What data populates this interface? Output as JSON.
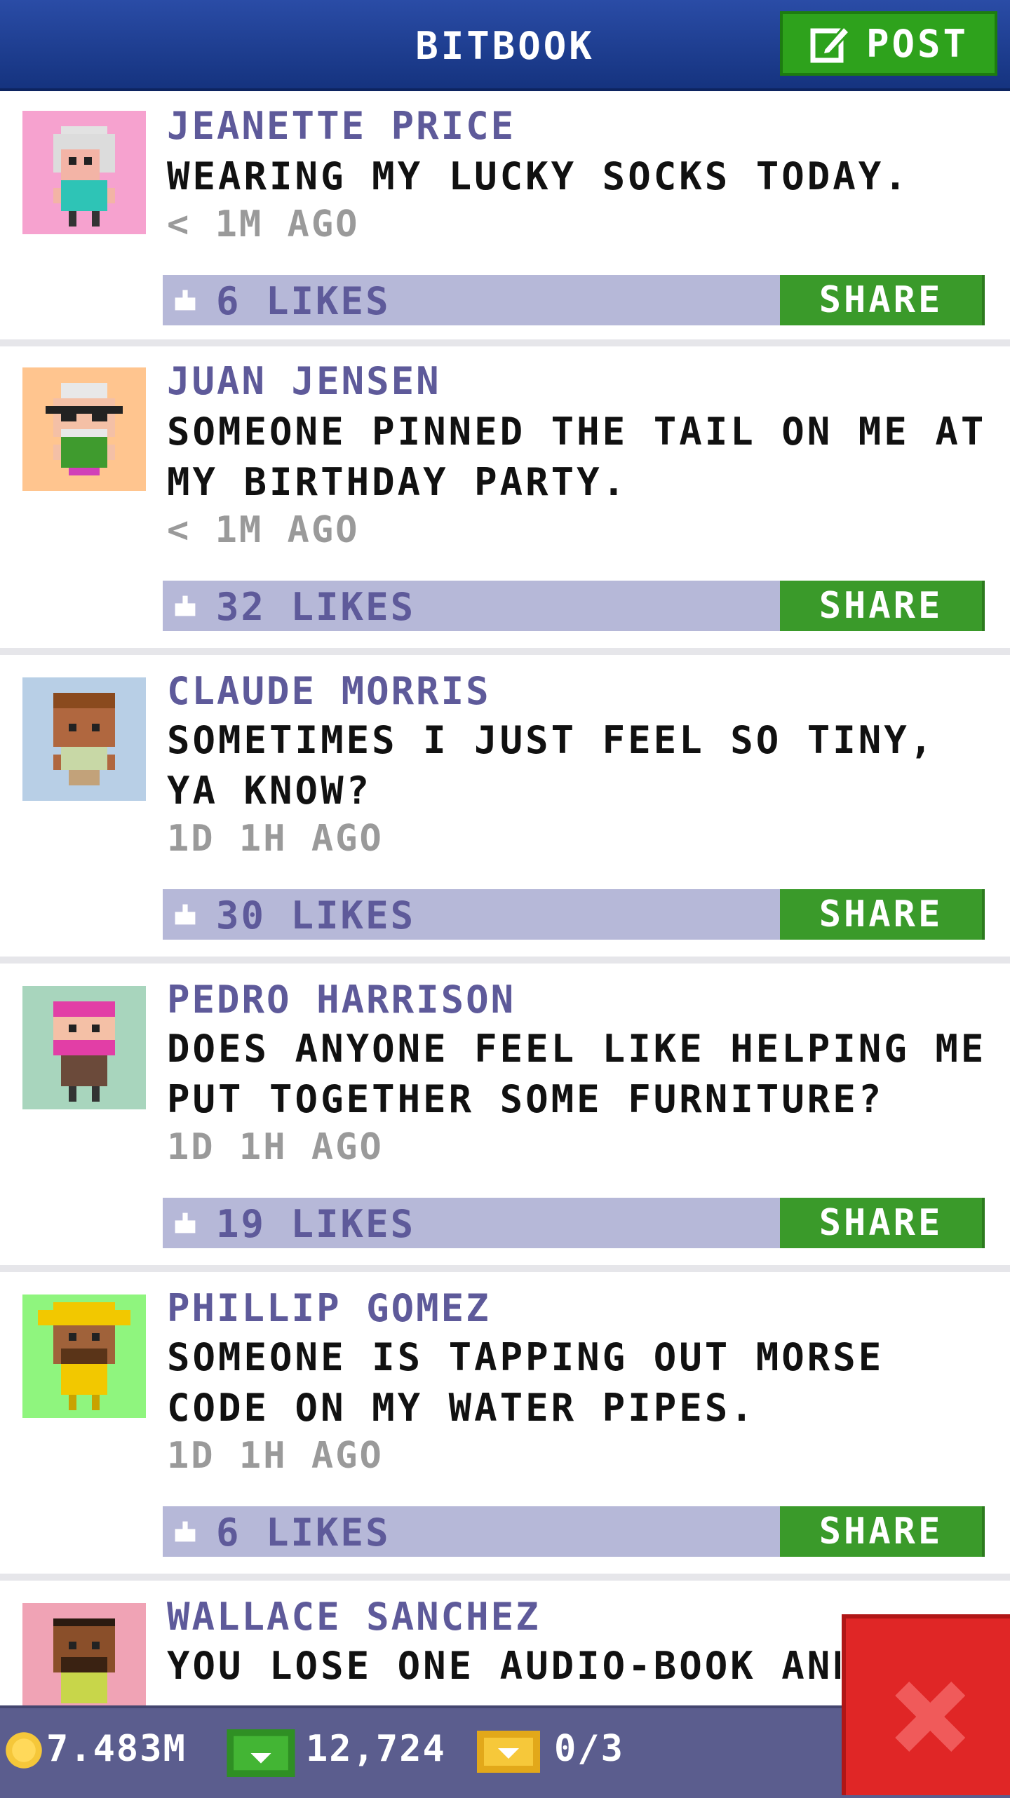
{
  "header": {
    "title": "BITBOOK",
    "post_label": "POST"
  },
  "posts": [
    {
      "name": "JEANETTE PRICE",
      "text": "WEARING MY LUCKY SOCKS TODAY.",
      "time": "< 1M AGO",
      "likes": "6 LIKES",
      "share": "SHARE",
      "avatar_bg": "#f6a2cf"
    },
    {
      "name": "JUAN JENSEN",
      "text": "SOMEONE PINNED THE TAIL ON ME AT MY BIRTHDAY PARTY.",
      "time": "< 1M AGO",
      "likes": "32 LIKES",
      "share": "SHARE",
      "avatar_bg": "#ffc58f"
    },
    {
      "name": "CLAUDE MORRIS",
      "text": "SOMETIMES I JUST FEEL SO TINY, YA KNOW?",
      "time": "1D 1H AGO",
      "likes": "30 LIKES",
      "share": "SHARE",
      "avatar_bg": "#b8cfe6"
    },
    {
      "name": "PEDRO HARRISON",
      "text": "DOES ANYONE FEEL LIKE HELPING ME PUT TOGETHER SOME FURNITURE?",
      "time": "1D 1H AGO",
      "likes": "19 LIKES",
      "share": "SHARE",
      "avatar_bg": "#a8d5bd"
    },
    {
      "name": "PHILLIP GOMEZ",
      "text": "SOMEONE IS TAPPING OUT MORSE CODE ON MY WATER PIPES.",
      "time": "1D 1H AGO",
      "likes": "6 LIKES",
      "share": "SHARE",
      "avatar_bg": "#8ff57e"
    },
    {
      "name": "WALLACE SANCHEZ",
      "text": "YOU LOSE ONE AUDIO-BOOK AND",
      "time": "",
      "likes": "",
      "share": "",
      "avatar_bg": "#f0a3b5"
    }
  ],
  "status": {
    "coins": "7.483M",
    "bux": "12,724",
    "tickets": "0/3"
  },
  "colors": {
    "header": "#1e3f96",
    "share": "#3a9a2a",
    "like_bar": "#b6b8d8",
    "name": "#5e5a9a",
    "close": "#e02626"
  }
}
